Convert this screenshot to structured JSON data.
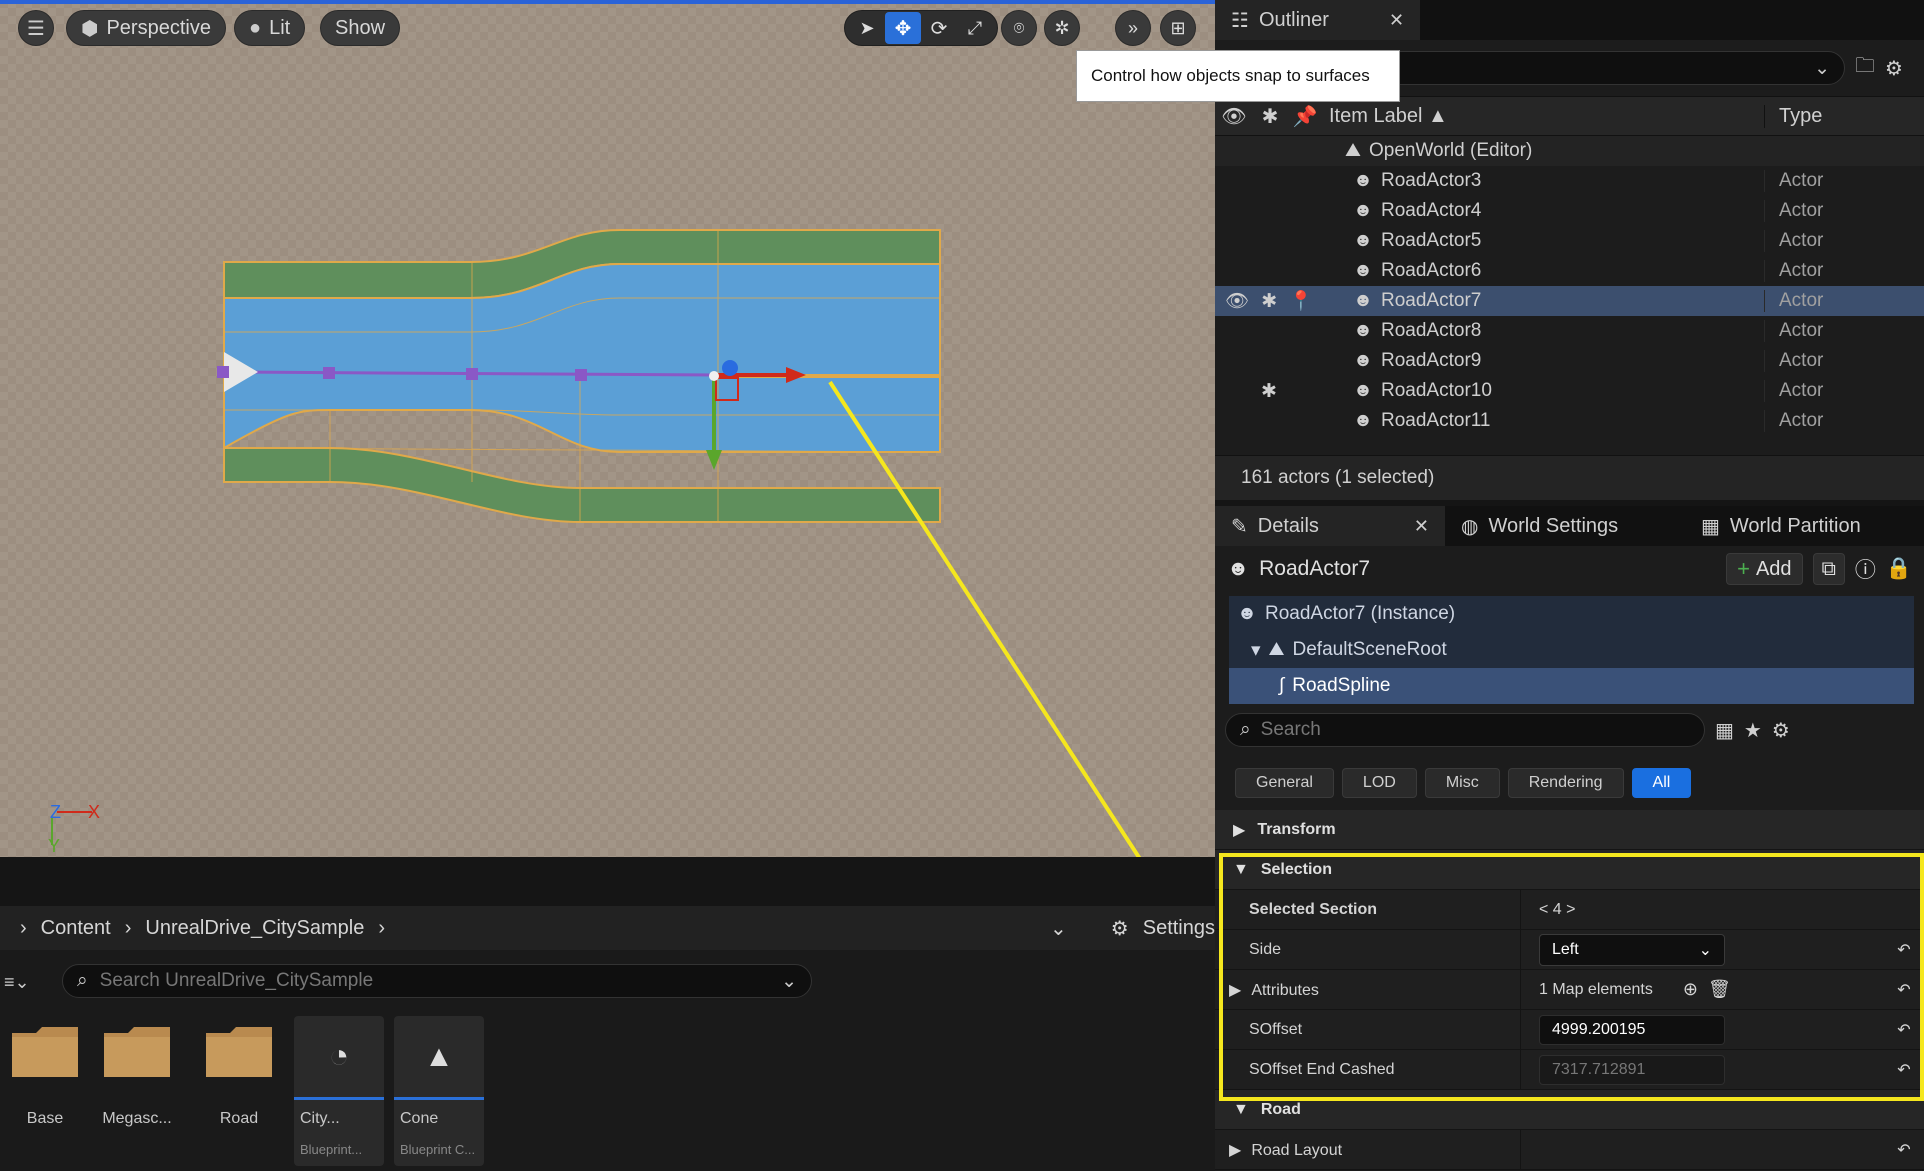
{
  "viewport": {
    "perspective_label": "Perspective",
    "lit_label": "Lit",
    "show_label": "Show",
    "tooltip": "Control how objects snap to surfaces",
    "axis_z": "Z",
    "axis_x": "X",
    "axis_y": "Y"
  },
  "outliner": {
    "tab_title": "Outliner",
    "col_label": "Item Label",
    "col_type": "Type",
    "root_label": "OpenWorld (Editor)",
    "rows": [
      {
        "label": "RoadActor3",
        "type": "Actor"
      },
      {
        "label": "RoadActor4",
        "type": "Actor"
      },
      {
        "label": "RoadActor5",
        "type": "Actor"
      },
      {
        "label": "RoadActor6",
        "type": "Actor"
      },
      {
        "label": "RoadActor7",
        "type": "Actor"
      },
      {
        "label": "RoadActor8",
        "type": "Actor"
      },
      {
        "label": "RoadActor9",
        "type": "Actor"
      },
      {
        "label": "RoadActor10",
        "type": "Actor"
      },
      {
        "label": "RoadActor11",
        "type": "Actor"
      }
    ],
    "count": "161 actors (1 selected)"
  },
  "details": {
    "tab_details": "Details",
    "tab_world_settings": "World Settings",
    "tab_world_partition": "World Partition",
    "actor_name": "RoadActor7",
    "add_label": "Add",
    "tree": {
      "instance": "RoadActor7 (Instance)",
      "root": "DefaultSceneRoot",
      "spline": "RoadSpline"
    },
    "search_placeholder": "Search",
    "filters": [
      "General",
      "LOD",
      "Misc",
      "Rendering",
      "All"
    ],
    "cat_transform": "Transform",
    "cat_selection": "Selection",
    "props": {
      "selected_section_label": "Selected Section",
      "selected_section_value": "< 4 >",
      "side_label": "Side",
      "side_value": "Left",
      "attributes_label": "Attributes",
      "attributes_value": "1 Map elements",
      "soffset_label": "SOffset",
      "soffset_value": "4999.200195",
      "soffset_end_label": "SOffset End Cashed",
      "soffset_end_value": "7317.712891"
    },
    "cat_road": "Road",
    "road_layout_label": "Road Layout"
  },
  "content_browser": {
    "crumb_content": "Content",
    "crumb_folder": "UnrealDrive_CitySample",
    "settings_label": "Settings",
    "search_placeholder": "Search UnrealDrive_CitySample",
    "assets": [
      {
        "name": "Base"
      },
      {
        "name": "Megasc..."
      },
      {
        "name": "Road"
      },
      {
        "name": "City...",
        "sub": "Blueprint..."
      },
      {
        "name": "Cone",
        "sub": "Blueprint C..."
      }
    ]
  }
}
